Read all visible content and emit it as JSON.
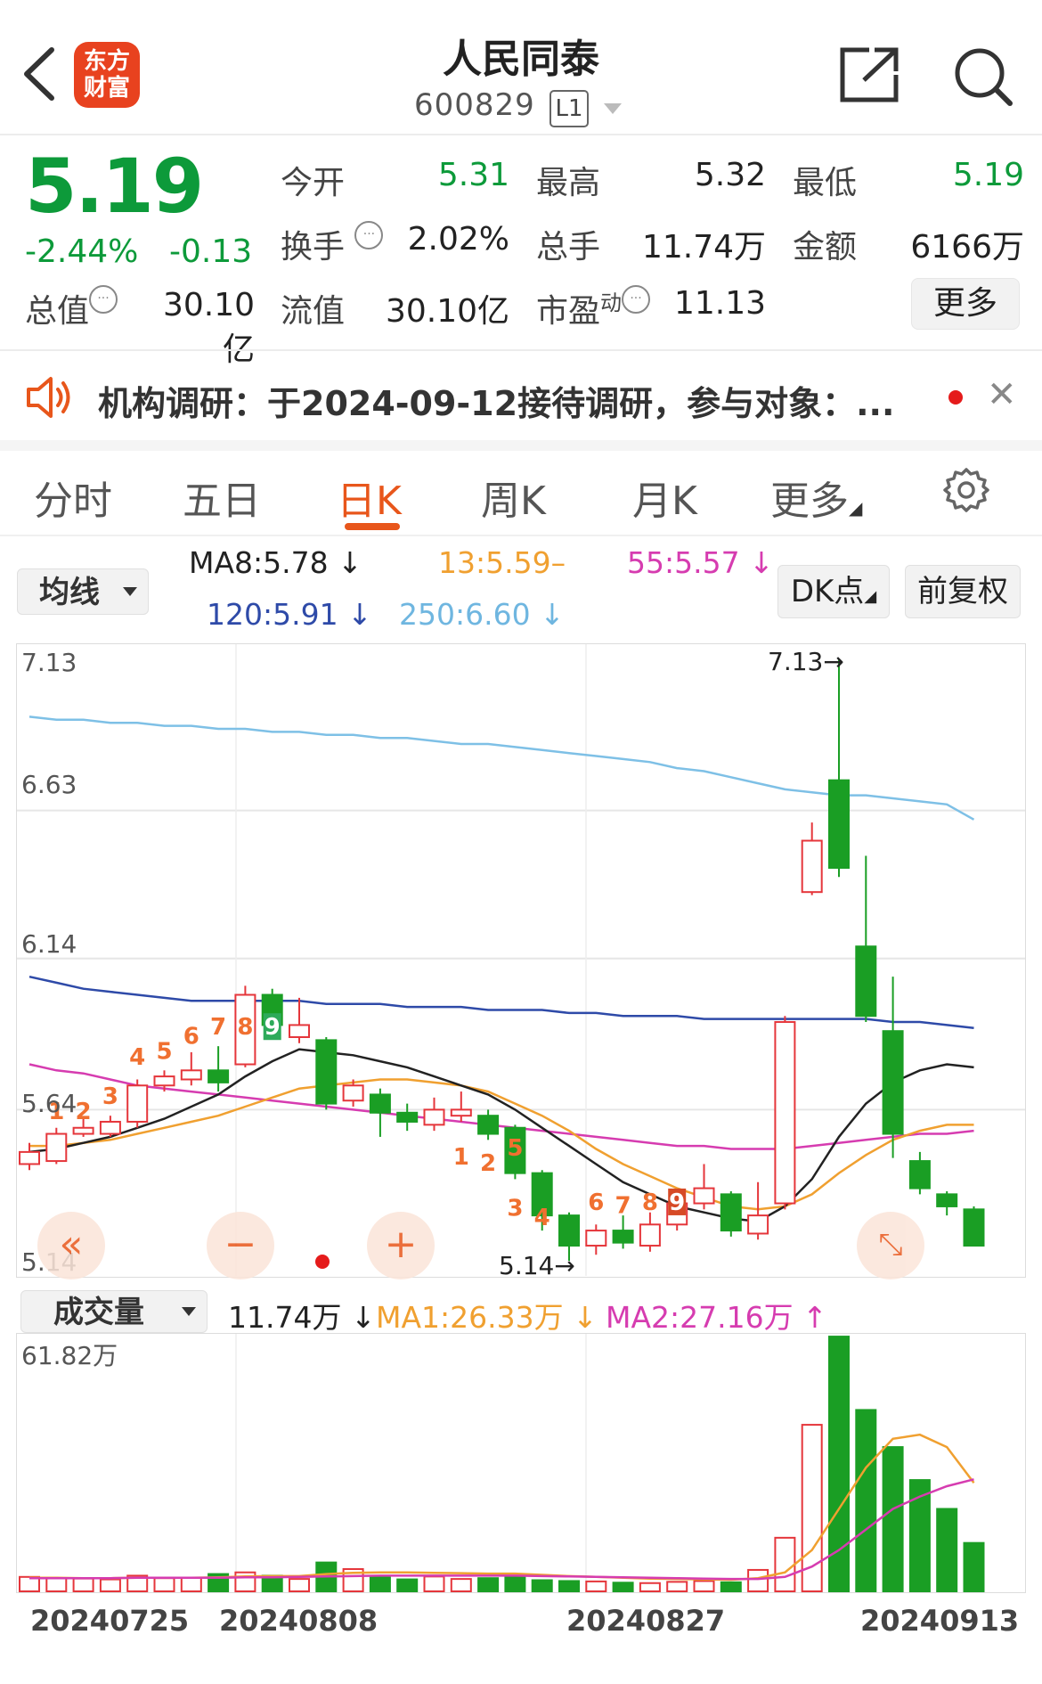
{
  "header": {
    "title": "人民同泰",
    "code": "600829",
    "market_badge": "L1",
    "logo_line1": "东方",
    "logo_line2": "财富"
  },
  "quote": {
    "price": "5.19",
    "change_pct": "-2.44%",
    "change": "-0.13",
    "open_label": "今开",
    "open": "5.31",
    "high_label": "最高",
    "high": "5.32",
    "low_label": "最低",
    "low": "5.19",
    "turnover_label": "换手",
    "turnover": "2.02%",
    "volume_label": "总手",
    "volume": "11.74万",
    "amount_label": "金额",
    "amount": "6166万",
    "mktcap_label": "总值",
    "mktcap": "30.10亿",
    "float_label": "流值",
    "float_cap": "30.10亿",
    "pe_label": "市盈",
    "pe_sup": "动",
    "pe": "11.13",
    "more_label": "更多"
  },
  "notice": {
    "text": "机构调研：于2024-09-12接待调研，参与对象：..."
  },
  "tabs": {
    "items": [
      "分时",
      "五日",
      "日K",
      "周K",
      "月K",
      "更多"
    ],
    "active": "日K"
  },
  "indicators": {
    "selector": "均线",
    "ma8": "MA8:5.78",
    "ma13": "13:5.59",
    "ma55": "55:5.57",
    "ma120": "120:5.91",
    "ma250": "250:6.60",
    "dk_label": "DK点",
    "adjust_label": "前复权",
    "colors": {
      "ma8": "#222222",
      "ma13": "#f0a030",
      "ma55": "#d63cb0",
      "ma120": "#2e4aa8",
      "ma250": "#7ec0e6"
    }
  },
  "volume": {
    "selector": "成交量",
    "vol": "11.74万",
    "ma1": "MA1:26.33万",
    "ma2": "MA2:27.16万",
    "axis_max": "61.82万"
  },
  "chart_data": {
    "type": "candlestick",
    "y_ticks": [
      "7.13",
      "6.63",
      "6.14",
      "5.64",
      "5.14"
    ],
    "ylim": [
      5.14,
      7.13
    ],
    "high_marker": "7.13",
    "low_marker": "5.14",
    "x_ticks": [
      "20240725",
      "20240808",
      "20240827",
      "20240913"
    ],
    "candles": [
      {
        "o": 5.46,
        "c": 5.5,
        "h": 5.53,
        "l": 5.44
      },
      {
        "o": 5.47,
        "c": 5.56,
        "h": 5.58,
        "l": 5.46
      },
      {
        "o": 5.56,
        "c": 5.58,
        "h": 5.61,
        "l": 5.55
      },
      {
        "o": 5.56,
        "c": 5.6,
        "h": 5.62,
        "l": 5.55
      },
      {
        "o": 5.6,
        "c": 5.72,
        "h": 5.74,
        "l": 5.58
      },
      {
        "o": 5.72,
        "c": 5.75,
        "h": 5.77,
        "l": 5.7
      },
      {
        "o": 5.74,
        "c": 5.77,
        "h": 5.83,
        "l": 5.72
      },
      {
        "o": 5.77,
        "c": 5.73,
        "h": 5.85,
        "l": 5.7
      },
      {
        "o": 5.79,
        "c": 6.02,
        "h": 6.05,
        "l": 5.78
      },
      {
        "o": 6.02,
        "c": 5.92,
        "h": 6.04,
        "l": 5.88
      },
      {
        "o": 5.88,
        "c": 5.92,
        "h": 6.01,
        "l": 5.86
      },
      {
        "o": 5.87,
        "c": 5.66,
        "h": 5.88,
        "l": 5.64
      },
      {
        "o": 5.67,
        "c": 5.72,
        "h": 5.74,
        "l": 5.65
      },
      {
        "o": 5.69,
        "c": 5.63,
        "h": 5.71,
        "l": 5.55
      },
      {
        "o": 5.63,
        "c": 5.6,
        "h": 5.66,
        "l": 5.57
      },
      {
        "o": 5.59,
        "c": 5.64,
        "h": 5.68,
        "l": 5.57
      },
      {
        "o": 5.62,
        "c": 5.64,
        "h": 5.7,
        "l": 5.6
      },
      {
        "o": 5.62,
        "c": 5.56,
        "h": 5.64,
        "l": 5.54
      },
      {
        "o": 5.58,
        "c": 5.43,
        "h": 5.59,
        "l": 5.41
      },
      {
        "o": 5.43,
        "c": 5.29,
        "h": 5.44,
        "l": 5.24
      },
      {
        "o": 5.29,
        "c": 5.19,
        "h": 5.3,
        "l": 5.14
      },
      {
        "o": 5.19,
        "c": 5.24,
        "h": 5.26,
        "l": 5.16
      },
      {
        "o": 5.24,
        "c": 5.2,
        "h": 5.29,
        "l": 5.18
      },
      {
        "o": 5.19,
        "c": 5.26,
        "h": 5.3,
        "l": 5.17
      },
      {
        "o": 5.26,
        "c": 5.33,
        "h": 5.36,
        "l": 5.24
      },
      {
        "o": 5.33,
        "c": 5.38,
        "h": 5.46,
        "l": 5.31
      },
      {
        "o": 5.36,
        "c": 5.24,
        "h": 5.37,
        "l": 5.22
      },
      {
        "o": 5.23,
        "c": 5.29,
        "h": 5.4,
        "l": 5.21
      },
      {
        "o": 5.33,
        "c": 5.93,
        "h": 5.95,
        "l": 5.31
      },
      {
        "o": 6.36,
        "c": 6.53,
        "h": 6.59,
        "l": 6.35
      },
      {
        "o": 6.73,
        "c": 6.44,
        "h": 7.13,
        "l": 6.41
      },
      {
        "o": 6.18,
        "c": 5.95,
        "h": 6.48,
        "l": 5.93
      },
      {
        "o": 5.9,
        "c": 5.56,
        "h": 6.08,
        "l": 5.48
      },
      {
        "o": 5.47,
        "c": 5.38,
        "h": 5.5,
        "l": 5.36
      },
      {
        "o": 5.36,
        "c": 5.32,
        "h": 5.37,
        "l": 5.29
      },
      {
        "o": 5.31,
        "c": 5.19,
        "h": 5.32,
        "l": 5.19
      }
    ],
    "ma8": [
      5.5,
      5.51,
      5.53,
      5.55,
      5.58,
      5.61,
      5.65,
      5.69,
      5.75,
      5.8,
      5.84,
      5.83,
      5.82,
      5.8,
      5.78,
      5.75,
      5.72,
      5.69,
      5.64,
      5.58,
      5.52,
      5.46,
      5.4,
      5.36,
      5.32,
      5.3,
      5.28,
      5.27,
      5.32,
      5.41,
      5.55,
      5.66,
      5.73,
      5.77,
      5.79,
      5.78
    ],
    "ma13": [
      5.52,
      5.52,
      5.53,
      5.54,
      5.56,
      5.58,
      5.6,
      5.62,
      5.65,
      5.68,
      5.71,
      5.72,
      5.73,
      5.74,
      5.74,
      5.73,
      5.72,
      5.7,
      5.66,
      5.62,
      5.57,
      5.51,
      5.46,
      5.42,
      5.38,
      5.35,
      5.32,
      5.31,
      5.32,
      5.36,
      5.43,
      5.49,
      5.54,
      5.57,
      5.59,
      5.59
    ],
    "ma55": [
      5.79,
      5.77,
      5.76,
      5.74,
      5.72,
      5.71,
      5.7,
      5.69,
      5.68,
      5.67,
      5.66,
      5.65,
      5.64,
      5.63,
      5.62,
      5.61,
      5.6,
      5.59,
      5.58,
      5.57,
      5.56,
      5.55,
      5.54,
      5.53,
      5.52,
      5.52,
      5.51,
      5.51,
      5.51,
      5.52,
      5.53,
      5.54,
      5.55,
      5.56,
      5.56,
      5.57
    ],
    "ma120": [
      6.08,
      6.06,
      6.04,
      6.03,
      6.02,
      6.01,
      6.0,
      6.0,
      6.0,
      6.0,
      6.0,
      5.99,
      5.99,
      5.99,
      5.98,
      5.98,
      5.98,
      5.97,
      5.97,
      5.97,
      5.96,
      5.96,
      5.95,
      5.95,
      5.95,
      5.94,
      5.94,
      5.94,
      5.94,
      5.94,
      5.94,
      5.94,
      5.93,
      5.93,
      5.92,
      5.91
    ],
    "ma250": [
      6.94,
      6.93,
      6.93,
      6.92,
      6.92,
      6.91,
      6.91,
      6.9,
      6.9,
      6.89,
      6.89,
      6.88,
      6.88,
      6.87,
      6.87,
      6.86,
      6.85,
      6.85,
      6.84,
      6.83,
      6.82,
      6.81,
      6.8,
      6.79,
      6.77,
      6.76,
      6.74,
      6.72,
      6.7,
      6.69,
      6.68,
      6.68,
      6.67,
      6.66,
      6.65,
      6.6
    ],
    "volume_ylim": [
      0,
      61.82
    ],
    "volumes": [
      3.5,
      3.2,
      3.1,
      2.9,
      3.8,
      3.2,
      3.3,
      4.2,
      4.6,
      3.8,
      3.0,
      7.0,
      5.4,
      3.7,
      2.9,
      3.6,
      3.0,
      3.2,
      3.5,
      2.7,
      2.5,
      2.4,
      2.1,
      2.0,
      2.3,
      2.5,
      2.2,
      5.2,
      13.0,
      40.4,
      61.8,
      44.0,
      35.0,
      27.0,
      20.0,
      11.74
    ],
    "vol_ma1": [
      3.3,
      3.3,
      3.2,
      3.2,
      3.3,
      3.3,
      3.3,
      3.4,
      3.6,
      3.7,
      3.7,
      4.2,
      4.5,
      4.6,
      4.6,
      4.5,
      4.4,
      4.3,
      4.3,
      4.0,
      3.7,
      3.5,
      3.3,
      3.1,
      3.0,
      2.9,
      2.8,
      3.2,
      4.6,
      10.0,
      20.0,
      30.0,
      37.0,
      38.0,
      35.0,
      26.33
    ],
    "vol_ma2": [
      3.2,
      3.2,
      3.2,
      3.2,
      3.3,
      3.3,
      3.3,
      3.3,
      3.4,
      3.4,
      3.5,
      3.6,
      3.7,
      3.8,
      3.8,
      3.8,
      3.8,
      3.8,
      3.8,
      3.7,
      3.6,
      3.5,
      3.4,
      3.3,
      3.2,
      3.1,
      3.0,
      3.0,
      3.5,
      6.0,
      10.0,
      15.0,
      20.0,
      23.0,
      25.5,
      27.16
    ],
    "nine_turn_up": [
      {
        "i": 1,
        "n": "1",
        "v": 5.62
      },
      {
        "i": 2,
        "n": "2",
        "v": 5.62
      },
      {
        "i": 3,
        "n": "3",
        "v": 5.67
      },
      {
        "i": 4,
        "n": "4",
        "v": 5.8
      },
      {
        "i": 5,
        "n": "5",
        "v": 5.82
      },
      {
        "i": 6,
        "n": "6",
        "v": 5.87
      },
      {
        "i": 7,
        "n": "7",
        "v": 5.9
      },
      {
        "i": 8,
        "n": "8",
        "v": 5.9
      },
      {
        "i": 9,
        "n": "9",
        "v": 5.9,
        "box": true
      }
    ],
    "nine_turn_down": [
      {
        "i": 16,
        "n": "1",
        "v": 5.47
      },
      {
        "i": 17,
        "n": "2",
        "v": 5.45
      },
      {
        "i": 18,
        "n": "3",
        "v": 5.3
      },
      {
        "i": 19,
        "n": "4",
        "v": 5.27
      },
      {
        "i": 18,
        "n": "5",
        "v": 5.5
      },
      {
        "i": 21,
        "n": "6",
        "v": 5.32
      },
      {
        "i": 22,
        "n": "7",
        "v": 5.31
      },
      {
        "i": 23,
        "n": "8",
        "v": 5.32
      },
      {
        "i": 24,
        "n": "9",
        "v": 5.32,
        "box": true
      }
    ]
  }
}
